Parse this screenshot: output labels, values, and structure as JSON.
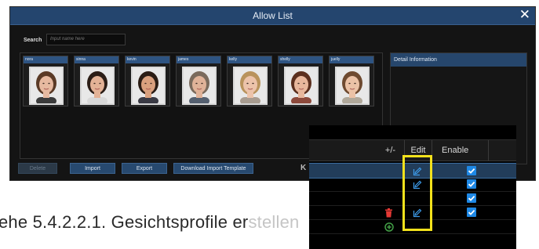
{
  "dialog": {
    "title": "Allow List",
    "close_symbol": "✕",
    "search_label": "Search",
    "search_placeholder": "Input name here",
    "detail_title": "Detail Information",
    "pager": "K",
    "buttons": {
      "delete": "Delete",
      "import": "Import",
      "export": "Export",
      "template": "Download Import Template"
    }
  },
  "faces": [
    {
      "name": "nora",
      "hair": "#5a3a26",
      "skin": "#e6b9a0",
      "shirt": "#3b3b3b"
    },
    {
      "name": "sinna",
      "hair": "#2b1d16",
      "skin": "#e3b296",
      "shirt": "#d8d8d8"
    },
    {
      "name": "kevin",
      "hair": "#2a1c14",
      "skin": "#d9a07e",
      "shirt": "#3a3a44"
    },
    {
      "name": "james",
      "hair": "#7a6a5c",
      "skin": "#e0b298",
      "shirt": "#556070"
    },
    {
      "name": "kelly",
      "hair": "#b9935c",
      "skin": "#ecc3aa",
      "shirt": "#a89c90"
    },
    {
      "name": "shelly",
      "hair": "#5b2f1e",
      "skin": "#e8b79c",
      "shirt": "#8d4a3c"
    },
    {
      "name": "juelly",
      "hair": "#6e4a30",
      "skin": "#ebc2a6",
      "shirt": "#b0a89a"
    }
  ],
  "zoom": {
    "headers": {
      "plusminus": "+/-",
      "edit": "Edit",
      "enable": "Enable",
      "chevron": "⌄"
    },
    "rows": [
      {
        "edit": true,
        "enabled": true,
        "trash": false,
        "add": false,
        "selected": true
      },
      {
        "edit": true,
        "enabled": true,
        "trash": false,
        "add": false,
        "selected": false
      },
      {
        "edit": false,
        "enabled": true,
        "trash": false,
        "add": false,
        "selected": false
      },
      {
        "edit": true,
        "enabled": true,
        "trash": true,
        "add": false,
        "selected": false
      },
      {
        "edit": false,
        "enabled": false,
        "trash": false,
        "add": true,
        "selected": false
      }
    ]
  },
  "caption": {
    "text": "ehe 5.4.2.2.1. Gesichtsprofile er",
    "faded_text": "stellen"
  },
  "colors": {
    "accent": "#1e88e5",
    "highlight": "#f3e21c",
    "trash": "#e53935",
    "add": "#43a047"
  }
}
